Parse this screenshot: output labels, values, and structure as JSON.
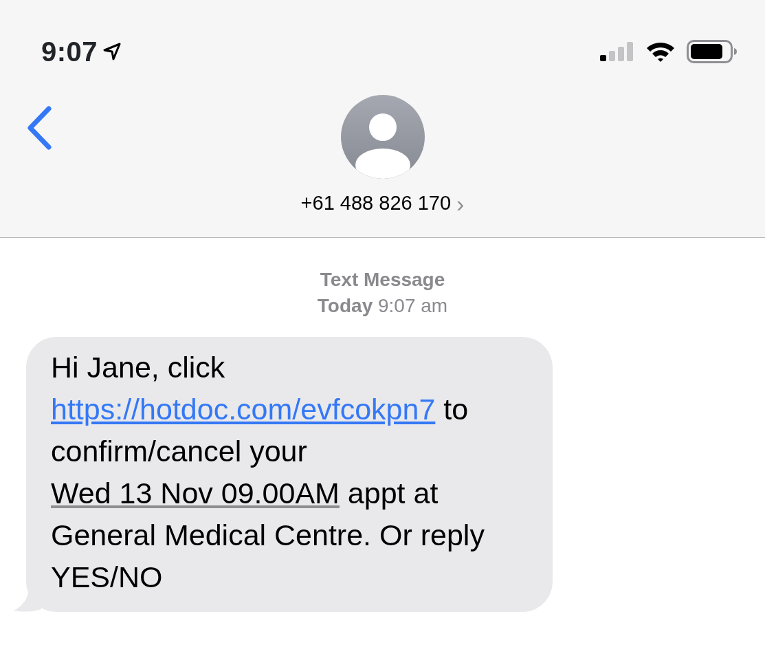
{
  "status_bar": {
    "time": "9:07"
  },
  "header": {
    "contact": "+61 488 826 170",
    "chevron": "›"
  },
  "thread": {
    "service": "Text Message",
    "timestamp": "**Today** 9:07 am",
    "messages": [
      {
        "kind": "incoming",
        "parts": [
          {
            "kind": "text",
            "text": "Hi Jane, click "
          },
          {
            "kind": "link",
            "text": "https://hotdoc.com/evfcokpn7"
          },
          {
            "kind": "text",
            "text": " to confirm/cancel your "
          },
          {
            "kind": "date",
            "text": "Wed 13 Nov 09.00AM"
          },
          {
            "kind": "text",
            "text": " appt at General Medical Centre. Or reply YES/NO"
          }
        ]
      }
    ]
  }
}
